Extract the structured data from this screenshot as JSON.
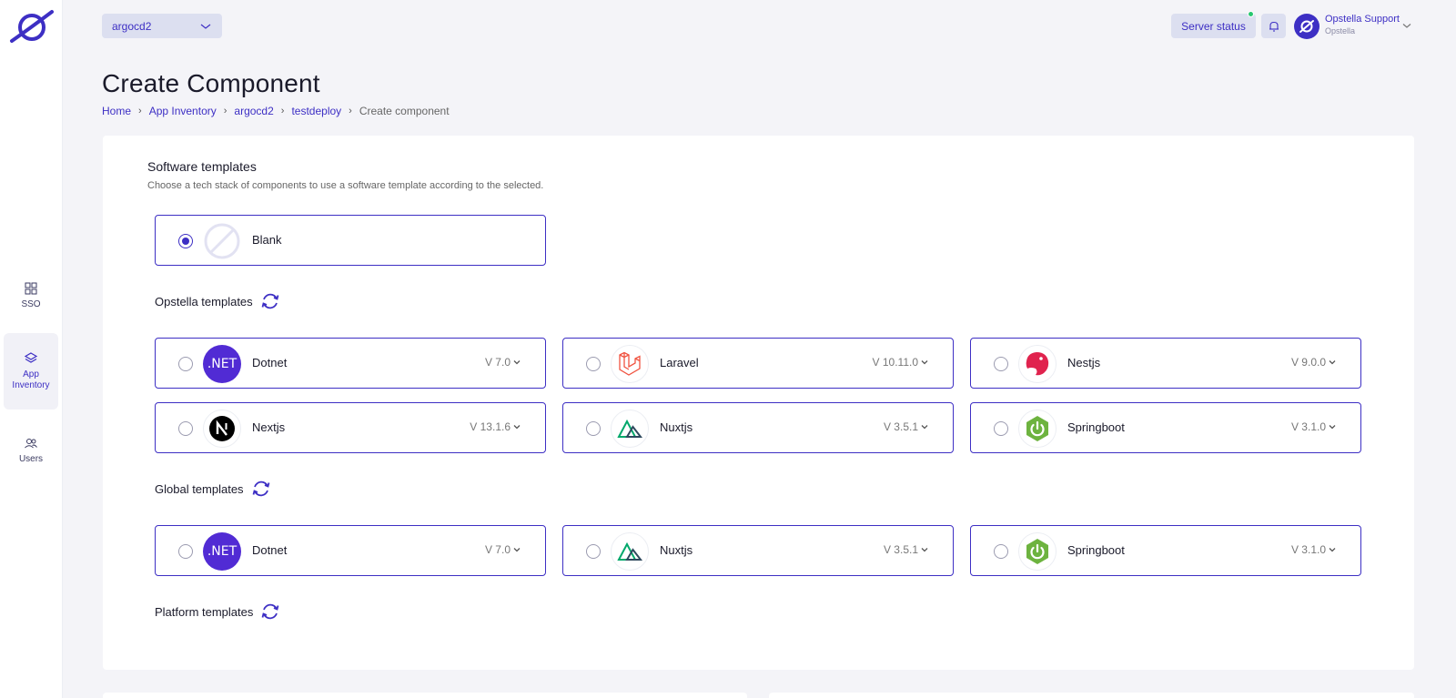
{
  "sidebar": {
    "items": [
      {
        "label": "SSO",
        "icon": "grid-icon"
      },
      {
        "label": "App Inventory",
        "icon": "layers-icon",
        "active": true
      },
      {
        "label": "Users",
        "icon": "users-icon"
      }
    ]
  },
  "topbar": {
    "context_select": "argocd2",
    "server_status": "Server status",
    "user_name": "Opstella Support",
    "user_org": "Opstella"
  },
  "page": {
    "title": "Create Component",
    "breadcrumb": [
      "Home",
      "App Inventory",
      "argocd2",
      "testdeploy",
      "Create component"
    ]
  },
  "software_templates": {
    "title": "Software templates",
    "description": "Choose a tech stack of components to use a software template according to the selected.",
    "blank_label": "Blank"
  },
  "opstella_templates": {
    "title": "Opstella templates",
    "items": [
      {
        "name": "Dotnet",
        "version": "V 7.0",
        "logo": "dotnet-logo"
      },
      {
        "name": "Laravel",
        "version": "V 10.11.0",
        "logo": "laravel-logo"
      },
      {
        "name": "Nestjs",
        "version": "V 9.0.0",
        "logo": "nestjs-logo"
      },
      {
        "name": "Nextjs",
        "version": "V 13.1.6",
        "logo": "nextjs-logo"
      },
      {
        "name": "Nuxtjs",
        "version": "V 3.5.1",
        "logo": "nuxtjs-logo"
      },
      {
        "name": "Springboot",
        "version": "V 3.1.0",
        "logo": "springboot-logo"
      }
    ]
  },
  "global_templates": {
    "title": "Global templates",
    "items": [
      {
        "name": "Dotnet",
        "version": "V 7.0",
        "logo": "dotnet-logo"
      },
      {
        "name": "Nuxtjs",
        "version": "V 3.5.1",
        "logo": "nuxtjs-logo"
      },
      {
        "name": "Springboot",
        "version": "V 3.1.0",
        "logo": "springboot-logo"
      }
    ]
  },
  "platform_templates": {
    "title": "Platform templates"
  },
  "logos": {
    "dotnet_text": ".NET"
  },
  "colors": {
    "accent": "#3d2fc4",
    "dotnet": "#512bd4",
    "laravel": "#f05340",
    "nestjs": "#e0234e",
    "nuxt": "#00dc82",
    "spring": "#6db33f"
  }
}
